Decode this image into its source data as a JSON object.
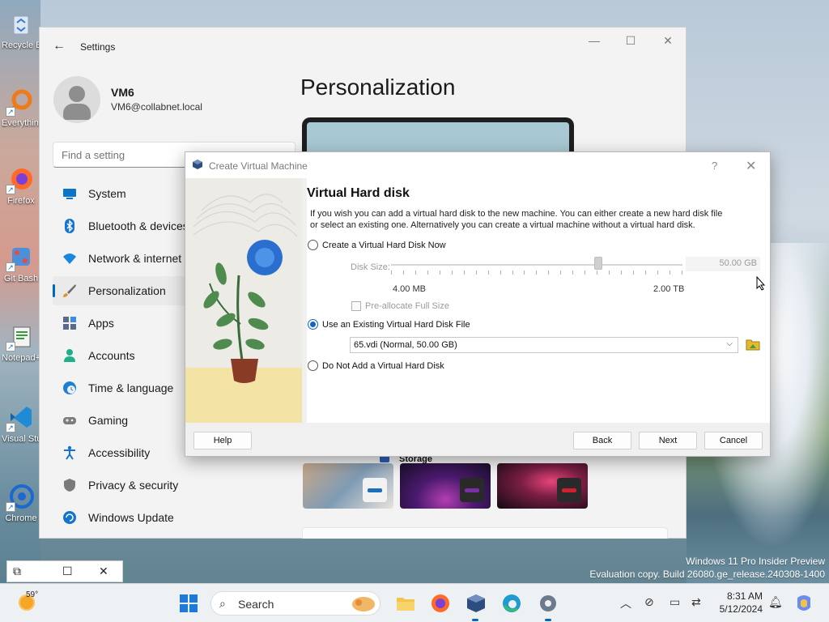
{
  "desktop": {
    "icons": [
      {
        "label": "Recycle Bin",
        "icon": "recycle-bin-icon"
      },
      {
        "label": "Everything",
        "icon": "everything-icon"
      },
      {
        "label": "Firefox",
        "icon": "firefox-icon"
      },
      {
        "label": "Git Bash",
        "icon": "git-bash-icon"
      },
      {
        "label": "Notepad++",
        "icon": "notepad-icon"
      },
      {
        "label": "Visual Studio Code",
        "icon": "vscode-icon"
      },
      {
        "label": "Chrome",
        "icon": "chrome-icon"
      }
    ],
    "watermark": {
      "line1": "Windows 11 Pro Insider Preview",
      "line2": "Evaluation copy. Build 26080.ge_release.240308-1400"
    }
  },
  "settings": {
    "title": "Settings",
    "user_name": "VM6",
    "user_email": "VM6@collabnet.local",
    "search_placeholder": "Find a setting",
    "page_title": "Personalization",
    "nav": [
      {
        "label": "System",
        "icon": "monitor-icon",
        "active": false
      },
      {
        "label": "Bluetooth & devices",
        "icon": "bluetooth-icon",
        "active": false
      },
      {
        "label": "Network & internet",
        "icon": "wifi-icon",
        "active": false
      },
      {
        "label": "Personalization",
        "icon": "brush-icon",
        "active": true
      },
      {
        "label": "Apps",
        "icon": "apps-icon",
        "active": false
      },
      {
        "label": "Accounts",
        "icon": "person-icon",
        "active": false
      },
      {
        "label": "Time & language",
        "icon": "globe-clock-icon",
        "active": false
      },
      {
        "label": "Gaming",
        "icon": "gamepad-icon",
        "active": false
      },
      {
        "label": "Accessibility",
        "icon": "accessibility-icon",
        "active": false
      },
      {
        "label": "Privacy & security",
        "icon": "shield-icon",
        "active": false
      },
      {
        "label": "Windows Update",
        "icon": "update-icon",
        "active": false
      }
    ],
    "storage_label": "Storage",
    "accent_color": "#0067c0"
  },
  "dialog": {
    "title": "Create Virtual Machine",
    "help_glyph": "?",
    "heading": "Virtual Hard disk",
    "description": "If you wish you can add a virtual hard disk to the new machine. You can either create a new hard disk file or select an existing one. Alternatively you can create a virtual machine without a virtual hard disk.",
    "option_create": "Create a Virtual Hard Disk Now",
    "disk_size_label": "Disk Size:",
    "disk_size_value": "50.00 GB",
    "slider_min": "4.00 MB",
    "slider_max": "2.00 TB",
    "slider_fraction": 0.71,
    "preallocate_label": "Pre-allocate Full Size",
    "option_existing": "Use an Existing Virtual Hard Disk File",
    "existing_file": "65.vdi (Normal, 50.00 GB)",
    "option_none": "Do Not Add a Virtual Hard Disk",
    "selected_option": "existing",
    "buttons": {
      "help": "Help",
      "back": "Back",
      "next": "Next",
      "cancel": "Cancel"
    }
  },
  "taskbar": {
    "temperature": "59°",
    "search_label": "Search",
    "time": "8:31 AM",
    "date": "5/12/2024",
    "apps": [
      "start-icon",
      "search-icon",
      "file-explorer-icon",
      "firefox-icon",
      "virtualbox-icon",
      "edge-icon",
      "settings-icon"
    ],
    "tray": [
      "chevron-up-icon",
      "network-off-icon",
      "display-icon",
      "language-icon",
      "bell-icon",
      "copilot-icon"
    ]
  }
}
